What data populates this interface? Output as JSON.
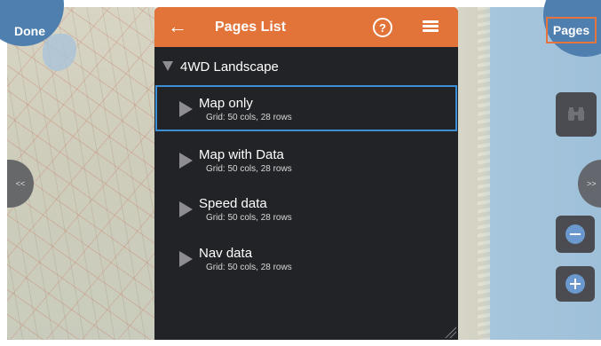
{
  "topbar": {
    "done_label": "Done",
    "pages_label": "Pages"
  },
  "side_tabs": {
    "left_label": "<<",
    "right_label": ">>"
  },
  "panel": {
    "title": "Pages List",
    "group_label": "4WD Landscape",
    "items": [
      {
        "name": "Map only",
        "sub": "Grid: 50 cols, 28 rows",
        "selected": true
      },
      {
        "name": "Map with Data",
        "sub": "Grid: 50 cols, 28 rows",
        "selected": false
      },
      {
        "name": "Speed data",
        "sub": "Grid: 50 cols, 28 rows",
        "selected": false
      },
      {
        "name": "Nav data",
        "sub": "Grid: 50 cols, 28 rows",
        "selected": false
      }
    ]
  },
  "icons": {
    "back": "arrow-left-icon",
    "help": "question-circle-icon",
    "menu": "hamburger-menu-icon",
    "binoculars": "binoculars-icon",
    "zoom_out": "minus-circle-icon",
    "zoom_in": "plus-circle-icon"
  },
  "colors": {
    "header_orange": "#e27439",
    "panel_bg": "#222326",
    "selection_blue": "#3b8fd6",
    "round_button_blue": "#4e7faf"
  }
}
